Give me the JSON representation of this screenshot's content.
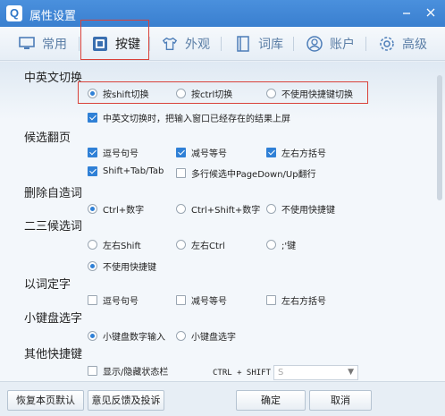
{
  "window": {
    "title": "属性设置",
    "logo": "Q"
  },
  "tabs": [
    {
      "label": "常用",
      "icon": "monitor-icon"
    },
    {
      "label": "按键",
      "icon": "keyboard-icon"
    },
    {
      "label": "外观",
      "icon": "shirt-icon"
    },
    {
      "label": "词库",
      "icon": "book-icon"
    },
    {
      "label": "账户",
      "icon": "user-icon"
    },
    {
      "label": "高级",
      "icon": "gear-icon"
    }
  ],
  "sections": {
    "switch": {
      "title": "中英文切换",
      "opt1": "按shift切换",
      "opt2": "按ctrl切换",
      "opt3": "不使用快捷键切换",
      "check": "中英文切换时，把输入窗口已经存在的结果上屏"
    },
    "paging": {
      "title": "候选翻页",
      "opt1": "逗号句号",
      "opt2": "减号等号",
      "opt3": "左右方括号",
      "opt4": "Shift+Tab/Tab",
      "opt5": "多行候选中PageDown/Up翻行"
    },
    "delete": {
      "title": "删除自造词",
      "opt1": "Ctrl+数字",
      "opt2": "Ctrl+Shift+数字",
      "opt3": "不使用快捷键"
    },
    "second": {
      "title": "二三候选词",
      "opt1": "左右Shift",
      "opt2": "左右Ctrl",
      "opt3": ";'键",
      "opt4": "不使用快捷键"
    },
    "wordfix": {
      "title": "以词定字",
      "opt1": "逗号句号",
      "opt2": "减号等号",
      "opt3": "左右方括号"
    },
    "keypad": {
      "title": "小键盘选字",
      "opt1": "小键盘数字输入",
      "opt2": "小键盘选字"
    },
    "other": {
      "title": "其他快捷键",
      "check": "显示/隐藏状态栏",
      "hotkey_label": "CTRL + SHIFT +",
      "hotkey_value": "S"
    }
  },
  "footer": {
    "reset": "恢复本页默认",
    "feedback": "意见反馈及投诉",
    "ok": "确定",
    "cancel": "取消"
  }
}
